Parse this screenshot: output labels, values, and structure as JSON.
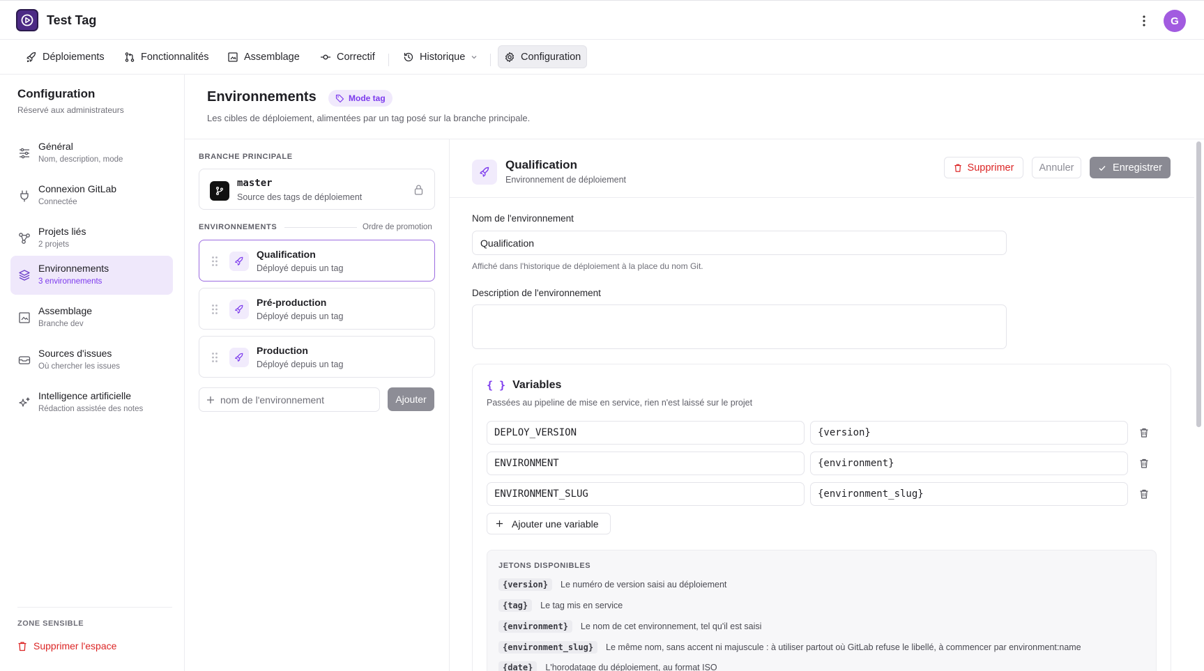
{
  "app": {
    "title": "Test Tag",
    "avatar_initial": "G",
    "brand_color": "#4c2a85",
    "accent_color": "#7c3aed"
  },
  "nav": {
    "deploys": "Déploiements",
    "features": "Fonctionnalités",
    "assembly": "Assemblage",
    "fix": "Correctif",
    "history": "Historique",
    "config": "Configuration"
  },
  "sidebar": {
    "title": "Configuration",
    "subtitle": "Réservé aux administrateurs",
    "items": [
      {
        "label": "Général",
        "desc": "Nom, description, mode",
        "icon": "sliders-icon"
      },
      {
        "label": "Connexion GitLab",
        "desc": "Connectée",
        "icon": "plug-icon"
      },
      {
        "label": "Projets liés",
        "desc": "2 projets",
        "icon": "nodes-icon"
      },
      {
        "label": "Environnements",
        "desc": "3 environnements",
        "icon": "layers-icon"
      },
      {
        "label": "Assemblage",
        "desc": "Branche dev",
        "icon": "frame-icon"
      },
      {
        "label": "Sources d'issues",
        "desc": "Où chercher les issues",
        "icon": "tray-icon"
      },
      {
        "label": "Intelligence artificielle",
        "desc": "Rédaction assistée des notes",
        "icon": "sparkles-icon"
      }
    ],
    "zone_title": "ZONE SENSIBLE",
    "delete_space": "Supprimer l'espace"
  },
  "main": {
    "title": "Environnements",
    "badge": "Mode tag",
    "desc": "Les cibles de déploiement, alimentées par un tag posé sur la branche principale."
  },
  "branch": {
    "section": "BRANCHE PRINCIPALE",
    "name": "master",
    "desc": "Source des tags de déploiement"
  },
  "envs": {
    "section": "ENVIRONNEMENTS",
    "promo": "Ordre de promotion",
    "items": [
      {
        "name": "Qualification",
        "desc": "Déployé depuis un tag"
      },
      {
        "name": "Pré-production",
        "desc": "Déployé depuis un tag"
      },
      {
        "name": "Production",
        "desc": "Déployé depuis un tag"
      }
    ],
    "add_placeholder": "nom de l'environnement",
    "add_button": "Ajouter"
  },
  "detail": {
    "title": "Qualification",
    "subtitle": "Environnement de déploiement",
    "delete": "Supprimer",
    "cancel": "Annuler",
    "save": "Enregistrer",
    "name_label": "Nom de l'environnement",
    "name_value": "Qualification",
    "name_help": "Affiché dans l'historique de déploiement à la place du nom Git.",
    "desc_label": "Description de l'environnement",
    "desc_value": ""
  },
  "variables": {
    "title": "Variables",
    "subtitle": "Passées au pipeline de mise en service, rien n'est laissé sur le projet",
    "rows": [
      {
        "key": "DEPLOY_VERSION",
        "value": "{version}"
      },
      {
        "key": "ENVIRONMENT",
        "value": "{environment}"
      },
      {
        "key": "ENVIRONMENT_SLUG",
        "value": "{environment_slug}"
      }
    ],
    "add": "Ajouter une variable"
  },
  "tokens": {
    "title": "JETONS DISPONIBLES",
    "items": [
      {
        "code": "{version}",
        "desc": "Le numéro de version saisi au déploiement"
      },
      {
        "code": "{tag}",
        "desc": "Le tag mis en service"
      },
      {
        "code": "{environment}",
        "desc": "Le nom de cet environnement, tel qu'il est saisi"
      },
      {
        "code": "{environment_slug}",
        "desc": "Le même nom, sans accent ni majuscule : à utiliser partout où GitLab refuse le libellé, à commencer par environment:name"
      },
      {
        "code": "{date}",
        "desc": "L'horodatage du déploiement, au format ISO"
      }
    ]
  }
}
